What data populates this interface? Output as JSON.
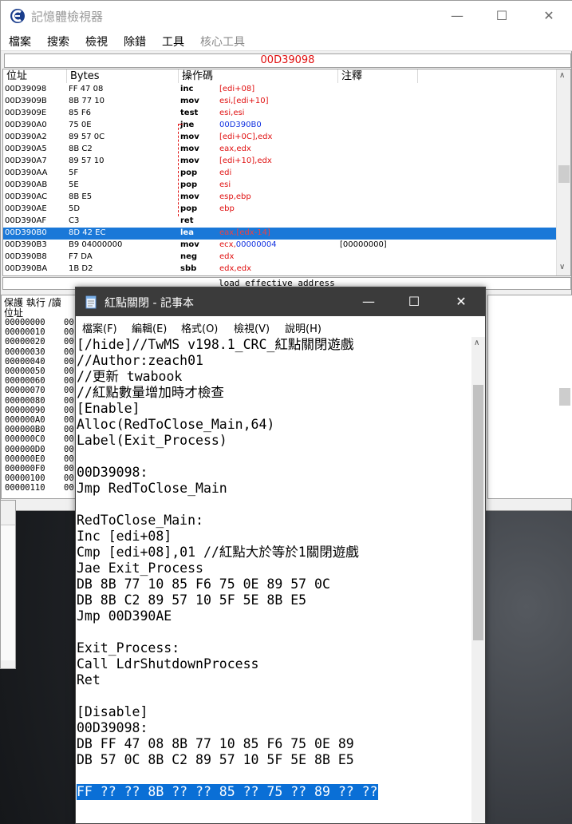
{
  "memory_viewer": {
    "title": "記憶體檢視器",
    "menu": [
      "檔案",
      "搜索",
      "檢視",
      "除錯",
      "工具",
      "核心工具"
    ],
    "address": "00D39098",
    "columns": [
      "位址",
      "Bytes",
      "操作碼",
      "注釋"
    ],
    "rows": [
      {
        "addr": "00D39098",
        "bytes": "FF 47 08",
        "op": "inc",
        "args": "[edi+08]",
        "comment": ""
      },
      {
        "addr": "00D3909B",
        "bytes": "8B 77 10",
        "op": "mov",
        "args": "esi,[edi+10]",
        "comment": ""
      },
      {
        "addr": "00D3909E",
        "bytes": "85 F6",
        "op": "test",
        "args": "esi,esi",
        "comment": ""
      },
      {
        "addr": "00D390A0",
        "bytes": "75 0E",
        "op": "jne",
        "args": "00D390B0",
        "comment": ""
      },
      {
        "addr": "00D390A2",
        "bytes": "89 57 0C",
        "op": "mov",
        "args": "[edi+0C],edx",
        "comment": ""
      },
      {
        "addr": "00D390A5",
        "bytes": "8B C2",
        "op": "mov",
        "args": "eax,edx",
        "comment": ""
      },
      {
        "addr": "00D390A7",
        "bytes": "89 57 10",
        "op": "mov",
        "args": "[edi+10],edx",
        "comment": ""
      },
      {
        "addr": "00D390AA",
        "bytes": "5F",
        "op": "pop",
        "args": "edi",
        "comment": ""
      },
      {
        "addr": "00D390AB",
        "bytes": "5E",
        "op": "pop",
        "args": "esi",
        "comment": ""
      },
      {
        "addr": "00D390AC",
        "bytes": "8B E5",
        "op": "mov",
        "args": "esp,ebp",
        "comment": ""
      },
      {
        "addr": "00D390AE",
        "bytes": "5D",
        "op": "pop",
        "args": "ebp",
        "comment": ""
      },
      {
        "addr": "00D390AF",
        "bytes": "C3",
        "op": "ret",
        "args": "",
        "comment": ""
      },
      {
        "addr": "00D390B0",
        "bytes": "8D 42 EC",
        "op": "lea",
        "args": "eax,[edx-14]",
        "comment": ""
      },
      {
        "addr": "00D390B3",
        "bytes": "B9 04000000",
        "op": "mov",
        "args": "ecx,00000004",
        "comment": "[00000000]"
      },
      {
        "addr": "00D390B8",
        "bytes": "F7 DA",
        "op": "neg",
        "args": "edx",
        "comment": ""
      },
      {
        "addr": "00D390BA",
        "bytes": "1B D2",
        "op": "sbb",
        "args": "edx,edx",
        "comment": ""
      }
    ],
    "selected_row": 12,
    "status": "load effective address",
    "hex_header_1": "保護 執行 /讀",
    "hex_header_2": "位址",
    "hex_rows": [
      {
        "addr": "00000000",
        "val": "00"
      },
      {
        "addr": "00000010",
        "val": "00"
      },
      {
        "addr": "00000020",
        "val": "00"
      },
      {
        "addr": "00000030",
        "val": "00"
      },
      {
        "addr": "00000040",
        "val": "00"
      },
      {
        "addr": "00000050",
        "val": "00"
      },
      {
        "addr": "00000060",
        "val": "00"
      },
      {
        "addr": "00000070",
        "val": "00"
      },
      {
        "addr": "00000080",
        "val": "00"
      },
      {
        "addr": "00000090",
        "val": "00"
      },
      {
        "addr": "000000A0",
        "val": "00"
      },
      {
        "addr": "000000B0",
        "val": "00"
      },
      {
        "addr": "000000C0",
        "val": "00"
      },
      {
        "addr": "000000D0",
        "val": "00"
      },
      {
        "addr": "000000E0",
        "val": "00"
      },
      {
        "addr": "000000F0",
        "val": "00"
      },
      {
        "addr": "00000100",
        "val": "00"
      },
      {
        "addr": "00000110",
        "val": "00"
      }
    ]
  },
  "notepad": {
    "title": "紅點關閉 - 記事本",
    "menu": [
      "檔案(F)",
      "編輯(E)",
      "格式(O)",
      "檢視(V)",
      "說明(H)"
    ],
    "lines": [
      "[/hide]//TwMS v198.1_CRC_紅點關閉遊戲",
      "//Author:zeach01",
      "//更新 twabook",
      "//紅點數量增加時才檢查",
      "[Enable]",
      "Alloc(RedToClose_Main,64)",
      "Label(Exit_Process)",
      "",
      "00D39098:",
      "Jmp RedToClose_Main",
      "",
      "RedToClose_Main:",
      "Inc [edi+08]",
      "Cmp [edi+08],01 //紅點大於等於1關閉遊戲",
      "Jae Exit_Process",
      "DB 8B 77 10 85 F6 75 0E 89 57 0C",
      "DB 8B C2 89 57 10 5F 5E 8B E5",
      "Jmp 00D390AE",
      "",
      "Exit_Process:",
      "Call LdrShutdownProcess",
      "Ret",
      "",
      "[Disable]",
      "00D39098:",
      "DB FF 47 08 8B 77 10 85 F6 75 0E 89",
      "DB 57 0C 8B C2 89 57 10 5F 5E 8B E5",
      "",
      "FF ?? ?? 8B ?? ?? 85 ?? 75 ?? 89 ?? ??"
    ],
    "highlighted_line": 28
  }
}
